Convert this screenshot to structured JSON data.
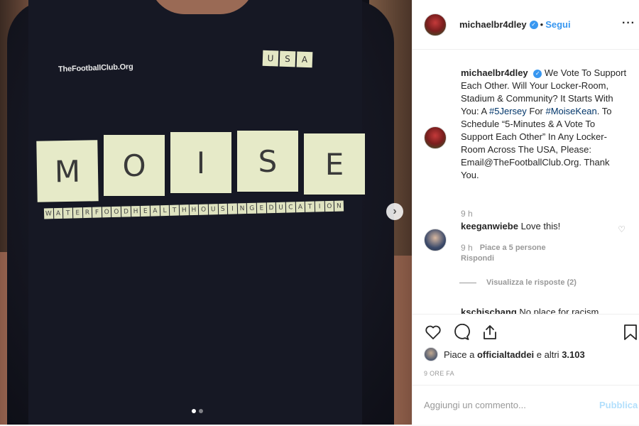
{
  "photo": {
    "shirt_logo": "TheFootballClub.Org",
    "usa_tiles": [
      "U",
      "S",
      "A"
    ],
    "moise_tiles": [
      "M",
      "O",
      "I",
      "S",
      "E"
    ],
    "strip_tiles": [
      "W",
      "A",
      "T",
      "E",
      "R",
      "F",
      "O",
      "O",
      "D",
      "H",
      "E",
      "A",
      "L",
      "T",
      "H",
      "H",
      "O",
      "U",
      "S",
      "I",
      "N",
      "G",
      "E",
      "D",
      "U",
      "C",
      "A",
      "T",
      "I",
      "O",
      "N"
    ],
    "next_icon": "chevron-right-icon",
    "carousel": {
      "total": 2,
      "active": 1
    }
  },
  "header": {
    "username": "michaelbr4dley",
    "verified_icon": "verified-badge-icon",
    "separator": "•",
    "follow_label": "Segui",
    "more_icon": "more-options-icon"
  },
  "caption": {
    "username": "michaelbr4dley",
    "text_1": "We Vote To Support Each Other. Will Your Locker-Room, Stadium & Community? It Starts With You: A ",
    "tag_1": "#5Jersey",
    "text_2": " For ",
    "tag_2": "#MoiseKean",
    "text_3": ". To Schedule “5-Minutes & A Vote To Support Each Other” In Any Locker-Room Across The USA, Please: Email@TheFootballClub.Org. Thank You.",
    "time": "9 h"
  },
  "comment": {
    "username": "keeganwiebe",
    "text": "Love this!",
    "time": "9 h",
    "likes": "Piace a 5 persone",
    "reply_label": "Rispondi",
    "view_replies": "Visualizza le risposte (2)"
  },
  "comment2": {
    "username": "kschischang",
    "text": "No place for racism"
  },
  "actions": {
    "likes_prefix": "Piace a ",
    "likes_user": "officialtaddei",
    "likes_suffix": " e altri ",
    "likes_count": "3.103",
    "date": "9 ORE FA"
  },
  "add_comment": {
    "placeholder": "Aggiungi un commento...",
    "publish_label": "Pubblica"
  },
  "colors": {
    "accent": "#3897f0",
    "hashtag": "#003569",
    "muted": "#999999",
    "publish_disabled": "#b2dffc"
  }
}
